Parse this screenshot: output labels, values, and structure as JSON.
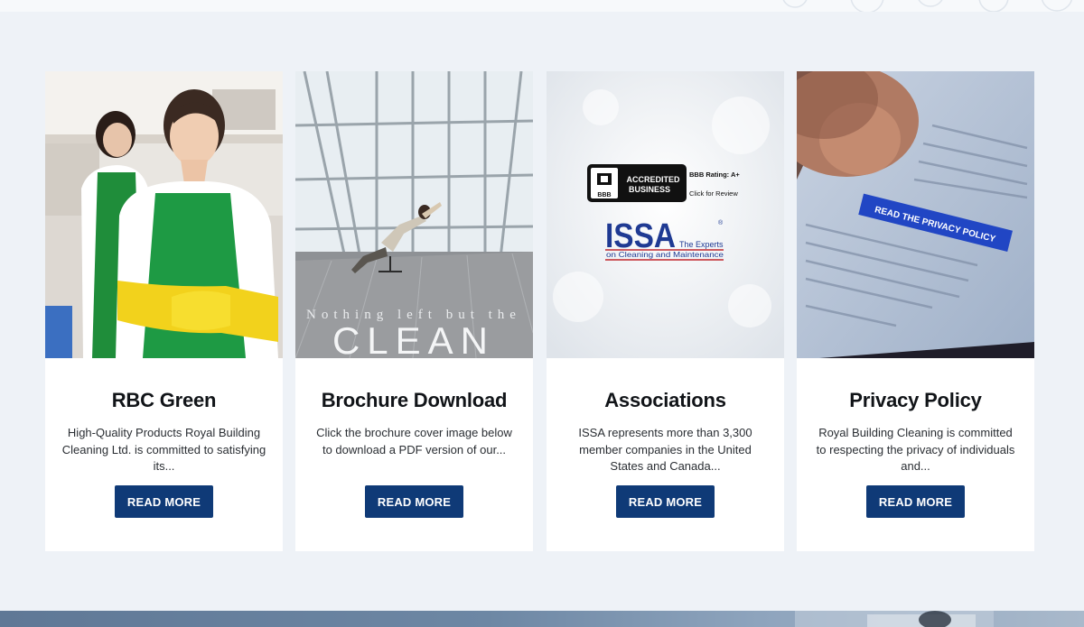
{
  "cards": [
    {
      "title": "RBC Green",
      "excerpt": "High-Quality Products Royal Building Cleaning Ltd. is committed to satisfying its...",
      "button": "READ MORE",
      "image_desc": "cleaning-staff-photo"
    },
    {
      "title": "Brochure Download",
      "excerpt": "Click the brochure cover image below to download a PDF version of our...",
      "button": "READ MORE",
      "image_desc": "brochure-cover",
      "image_text": {
        "line1": "Nothing left but the",
        "line2": "CLEAN"
      }
    },
    {
      "title": "Associations",
      "excerpt": "ISSA represents more than 3,300 member companies in the United States and Canada...",
      "button": "READ MORE",
      "image_desc": "association-logos",
      "image_text": {
        "bbb_accredited": "ACCREDITED",
        "bbb_business": "BUSINESS",
        "bbb_mark": "BBB",
        "bbb_rating": "BBB Rating: A+",
        "bbb_review": "Click for Review",
        "issa": "ISSA",
        "issa_tag1": "The Experts",
        "issa_tag2": "on Cleaning and Maintenance"
      }
    },
    {
      "title": "Privacy Policy",
      "excerpt": "Royal Building Cleaning is committed to respecting the privacy of individuals and...",
      "button": "READ MORE",
      "image_desc": "privacy-phone-photo",
      "image_text": {
        "banner": "READ THE PRIVACY POLICY"
      }
    }
  ],
  "colors": {
    "page_background": "#eef2f7",
    "card_background": "#ffffff",
    "button_background": "#0f3a77",
    "button_text": "#ffffff",
    "title_text": "#111418"
  }
}
